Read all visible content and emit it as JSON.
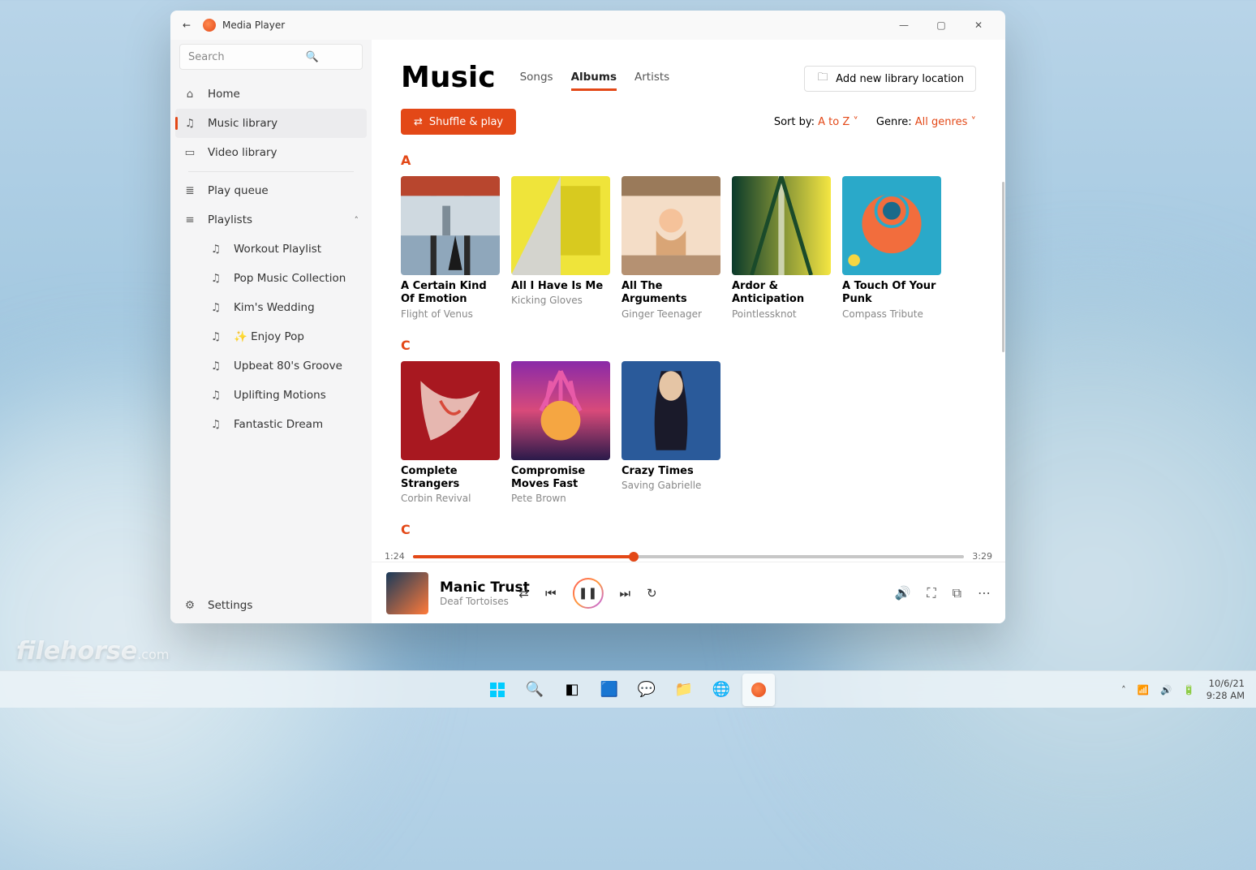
{
  "app_title": "Media Player",
  "search_placeholder": "Search",
  "nav": {
    "home": "Home",
    "music": "Music library",
    "video": "Video library",
    "queue": "Play queue",
    "playlists": "Playlists",
    "settings": "Settings"
  },
  "playlists": [
    "Workout Playlist",
    "Pop Music Collection",
    "Kim's Wedding",
    "✨ Enjoy Pop",
    "Upbeat 80's Groove",
    "Uplifting Motions",
    "Fantastic Dream"
  ],
  "header": {
    "title": "Music",
    "tab_songs": "Songs",
    "tab_albums": "Albums",
    "tab_artists": "Artists",
    "add_library": "Add new library location"
  },
  "toolbar": {
    "shuffle": "Shuffle & play",
    "sort_label": "Sort by:",
    "sort_value": "A to Z",
    "genre_label": "Genre:",
    "genre_value": "All genres"
  },
  "letters": {
    "a": "A",
    "c": "C",
    "c2": "C"
  },
  "albums_a": [
    {
      "title": "A Certain Kind Of Emotion",
      "artist": "Flight of Venus"
    },
    {
      "title": "All I Have Is Me",
      "artist": "Kicking Gloves"
    },
    {
      "title": "All The Arguments",
      "artist": "Ginger Teenager"
    },
    {
      "title": "Ardor & Anticipation",
      "artist": "Pointlessknot"
    },
    {
      "title": "A Touch Of Your Punk",
      "artist": "Compass Tribute"
    }
  ],
  "albums_c": [
    {
      "title": "Complete Strangers",
      "artist": "Corbin Revival"
    },
    {
      "title": "Compromise Moves Fast",
      "artist": "Pete Brown"
    },
    {
      "title": "Crazy Times",
      "artist": "Saving Gabrielle"
    }
  ],
  "now_playing": {
    "title": "Manic Trust",
    "artist": "Deaf Tortoises",
    "elapsed": "1:24",
    "duration": "3:29"
  },
  "tray": {
    "date": "10/6/21",
    "time": "9:28 AM"
  },
  "watermark": "filehorse",
  "watermark_tld": ".com"
}
